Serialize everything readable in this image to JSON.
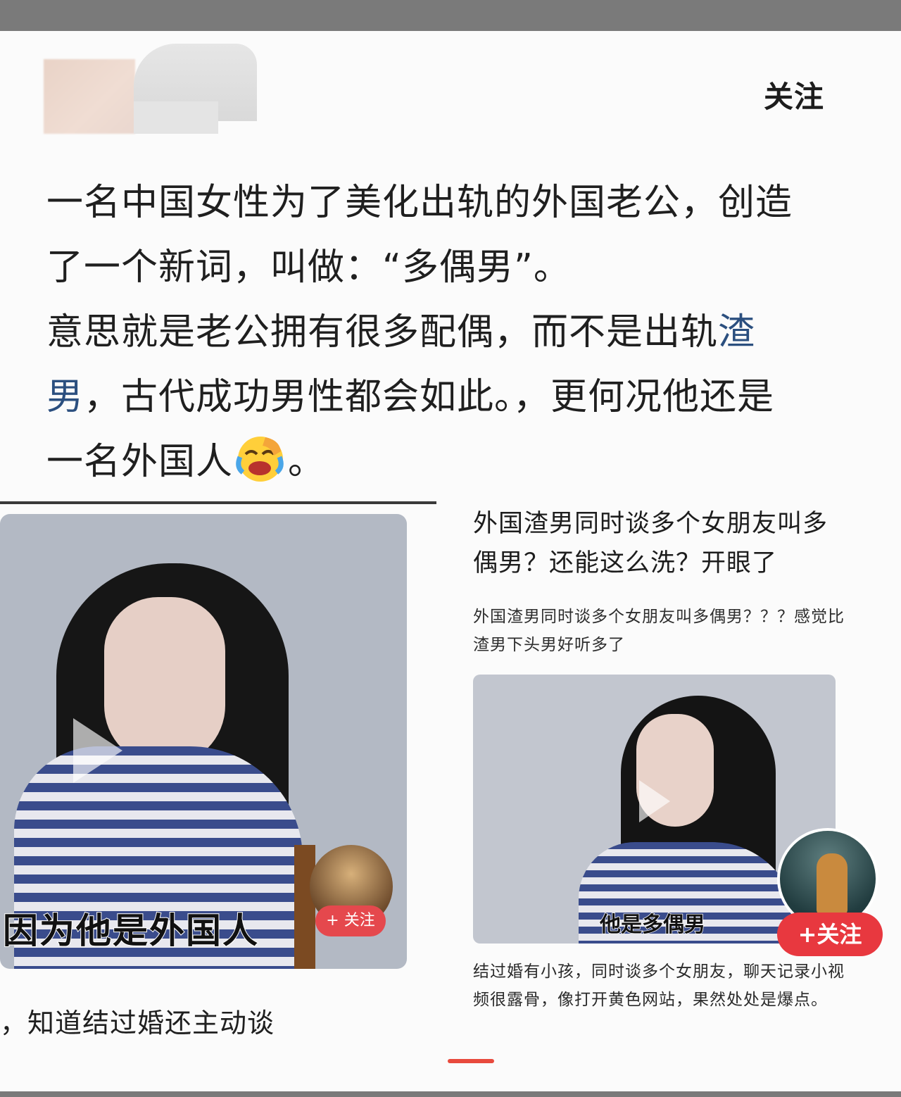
{
  "header": {
    "follow_label": "关注"
  },
  "post": {
    "line1": "一名中国女性为了美化出轨的外国老公，创造",
    "line2": "了一个新词，叫做：“多偶男”。",
    "line3_before_link": "意思就是老公拥有很多配偶，而不是出轨",
    "line3_link": "渣",
    "line4_link": "男",
    "line4_after_link": "，古代成功男性都会如此。，更何况他还是",
    "line5": "一名外国人",
    "line5_end": "。",
    "emoji": "laughing-crying-emoji"
  },
  "left_card": {
    "caption": "因为他是外国人",
    "follow_label": "+ 关注",
    "below_text": "，知道结过婚还主动谈"
  },
  "right_card": {
    "title": "外国渣男同时谈多个女朋友叫多偶男？还能这么洗？开眼了",
    "subtitle": "外国渣男同时谈多个女朋友叫多偶男？？？感觉比渣男下头男好听多了",
    "caption": "他是多偶男",
    "follow_label": "+关注",
    "body": "结过婚有小孩，同时谈多个女朋友，聊天记录小视频很露骨，像打开黄色网站，果然处处是爆点。"
  },
  "colors": {
    "accent": "#e8383f",
    "link": "#2b4f7f"
  }
}
